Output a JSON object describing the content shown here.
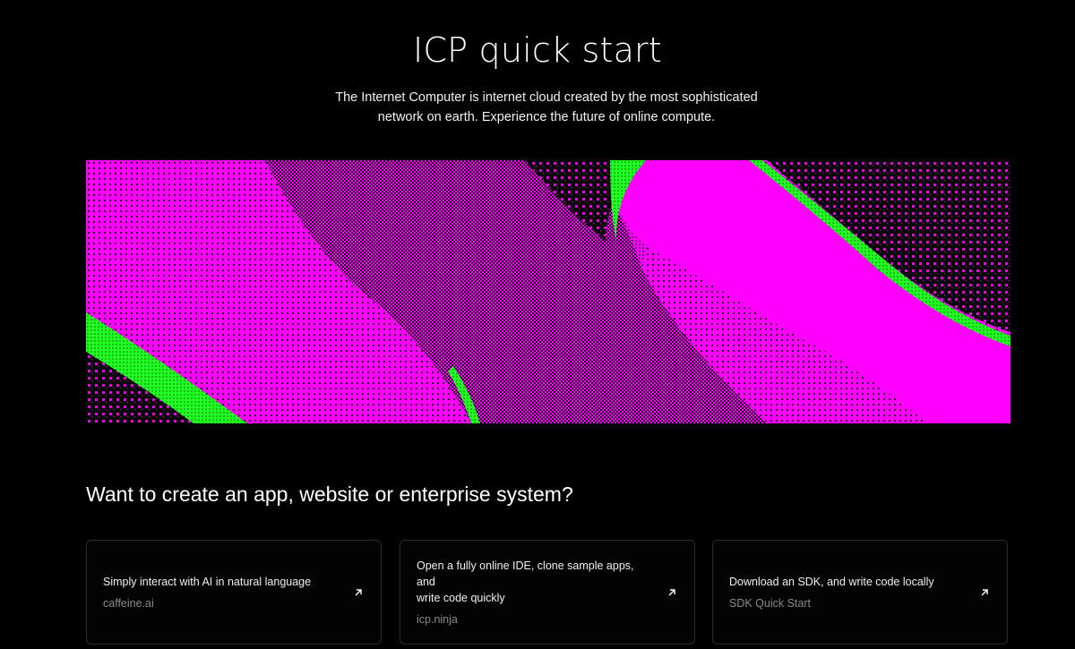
{
  "header": {
    "title": "ICP quick start",
    "intro_line_1": "The Internet Computer is internet cloud created by the most sophisticated",
    "intro_line_2": "network on earth. Experience the future of online compute."
  },
  "hero": {
    "colors": {
      "magenta": "#ff00ff",
      "deep_purple": "#6d0f6b",
      "green": "#22ff22",
      "black": "#000000"
    }
  },
  "section": {
    "heading": "Want to create an app, website or enterprise system?"
  },
  "cards": [
    {
      "description": "Simply interact with AI in natural language",
      "link": "caffeine.ai",
      "icon": "arrow-up-right-icon"
    },
    {
      "description_line_1": "Open a fully online IDE, clone sample apps, and",
      "description_line_2": "write code quickly",
      "link": "icp.ninja",
      "icon": "arrow-up-right-icon"
    },
    {
      "description": "Download an SDK, and write code locally",
      "link": "SDK Quick Start",
      "icon": "arrow-up-right-icon"
    }
  ]
}
